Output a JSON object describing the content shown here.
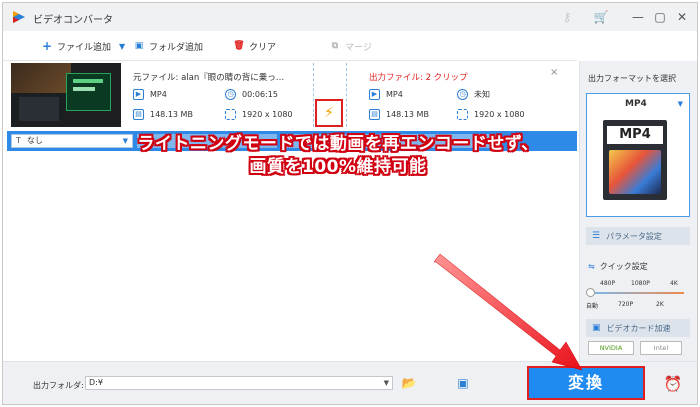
{
  "window": {
    "title": "ビデオコンバータ",
    "controls": {
      "minimize": "—",
      "maximize": "▢",
      "close": "✕"
    },
    "extra_icons": [
      "key-icon",
      "cart-icon"
    ]
  },
  "toolbar": {
    "add_file": "ファイル追加",
    "add_folder": "フォルダ追加",
    "clear": "クリア",
    "merge": "マージ"
  },
  "item": {
    "source_label": "元ファイル: alan『眼の睛の背に乗っ…",
    "source": {
      "format": "MP4",
      "duration": "00:06:15",
      "size": "148.13 MB",
      "resolution": "1920 x 1080"
    },
    "output_label": "出力ファイル: 2 クリップ",
    "output": {
      "format": "MP4",
      "duration": "未知",
      "size": "148.13 MB",
      "resolution": "1920 x 1080"
    },
    "close": "×"
  },
  "subtitle_bar": {
    "subtitle_value": "なし"
  },
  "banner": {
    "line1": "ライトニングモードでは動画を再エンコードせず、",
    "line2": "画質を100%維持可能"
  },
  "right_panel": {
    "title": "出力フォーマットを選択",
    "format": "MP4",
    "format_icon_label": "MP4",
    "param_settings": "パラメータ設定",
    "quick_settings": "クイック設定",
    "ticks_top": [
      "480P",
      "1080P",
      "4K"
    ],
    "ticks_bottom": [
      "自動",
      "720P",
      "2K"
    ],
    "gpu_accel": "ビデオカード加速",
    "gpu_nvidia": "NVIDIA",
    "gpu_intel": "Intel"
  },
  "bottom": {
    "output_folder_label": "出力フォルダ:",
    "output_folder_value": "D:¥",
    "convert": "変換"
  },
  "colors": {
    "accent": "#2e8ae6",
    "highlight": "#e02020",
    "bolt": "#f5a000"
  }
}
